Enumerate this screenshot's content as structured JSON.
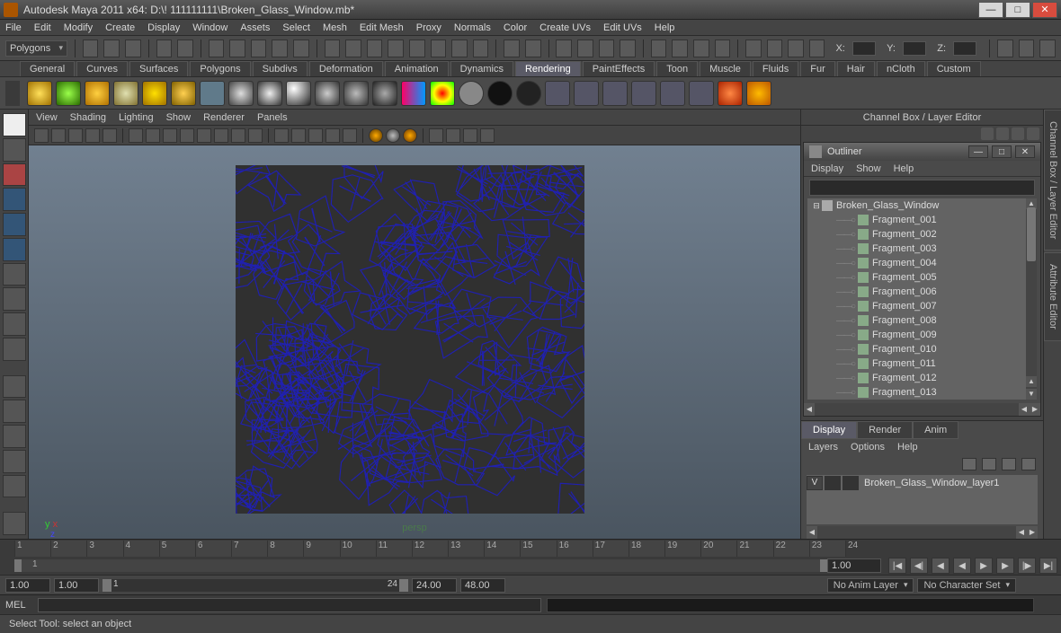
{
  "titlebar": {
    "title": "Autodesk Maya 2011 x64: D:\\! 111111111\\Broken_Glass_Window.mb*"
  },
  "menus": [
    "File",
    "Edit",
    "Modify",
    "Create",
    "Display",
    "Window",
    "Assets",
    "Select",
    "Mesh",
    "Edit Mesh",
    "Proxy",
    "Normals",
    "Color",
    "Create UVs",
    "Edit UVs",
    "Help"
  ],
  "module": "Polygons",
  "coords": {
    "x_label": "X:",
    "y_label": "Y:",
    "z_label": "Z:"
  },
  "shelf_tabs": [
    "General",
    "Curves",
    "Surfaces",
    "Polygons",
    "Subdivs",
    "Deformation",
    "Animation",
    "Dynamics",
    "Rendering",
    "PaintEffects",
    "Toon",
    "Muscle",
    "Fluids",
    "Fur",
    "Hair",
    "nCloth",
    "Custom"
  ],
  "shelf_active": "Rendering",
  "viewport_menus": [
    "View",
    "Shading",
    "Lighting",
    "Show",
    "Renderer",
    "Panels"
  ],
  "viewport": {
    "camera": "persp",
    "axes": {
      "x": "x",
      "y": "y",
      "z": "z"
    }
  },
  "channel_title": "Channel Box / Layer Editor",
  "outliner": {
    "title": "Outliner",
    "menus": [
      "Display",
      "Show",
      "Help"
    ],
    "root": "Broken_Glass_Window",
    "children": [
      "Fragment_001",
      "Fragment_002",
      "Fragment_003",
      "Fragment_004",
      "Fragment_005",
      "Fragment_006",
      "Fragment_007",
      "Fragment_008",
      "Fragment_009",
      "Fragment_010",
      "Fragment_011",
      "Fragment_012",
      "Fragment_013"
    ]
  },
  "layereditor": {
    "tabs": [
      "Display",
      "Render",
      "Anim"
    ],
    "active": "Display",
    "menus": [
      "Layers",
      "Options",
      "Help"
    ],
    "layer_vis": "V",
    "layer_name": "Broken_Glass_Window_layer1"
  },
  "rsidebar": {
    "tab1": "Channel Box / Layer Editor",
    "tab2": "Attribute Editor"
  },
  "timeslider": {
    "ticks": [
      "1",
      "2",
      "3",
      "4",
      "5",
      "6",
      "7",
      "8",
      "9",
      "10",
      "11",
      "12",
      "13",
      "14",
      "15",
      "16",
      "17",
      "18",
      "19",
      "20",
      "21",
      "22",
      "23",
      "24"
    ],
    "current_frame": "1.00",
    "range_left": "1",
    "range_right": "24"
  },
  "rangerow": {
    "start": "1.00",
    "in": "1.00",
    "out": "24",
    "end": "24.00",
    "slide_left": "1",
    "slide_right": "24",
    "fps": "48.00",
    "anim_layer": "No Anim Layer",
    "char_set": "No Character Set"
  },
  "cmdline": {
    "lang": "MEL"
  },
  "helpline": {
    "text": "Select Tool: select an object"
  }
}
